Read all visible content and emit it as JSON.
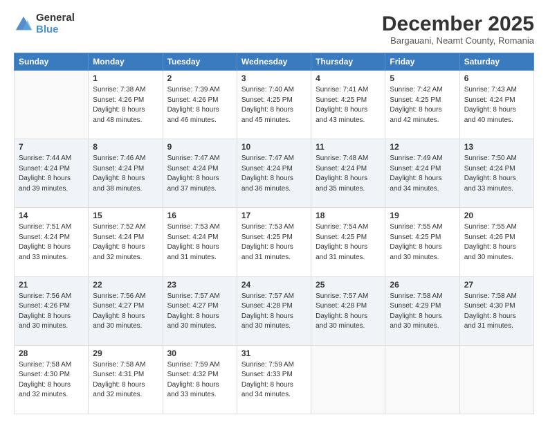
{
  "logo": {
    "general": "General",
    "blue": "Blue"
  },
  "title": "December 2025",
  "subtitle": "Bargauani, Neamt County, Romania",
  "weekdays": [
    "Sunday",
    "Monday",
    "Tuesday",
    "Wednesday",
    "Thursday",
    "Friday",
    "Saturday"
  ],
  "weeks": [
    [
      {
        "day": "",
        "info": ""
      },
      {
        "day": "1",
        "info": "Sunrise: 7:38 AM\nSunset: 4:26 PM\nDaylight: 8 hours\nand 48 minutes."
      },
      {
        "day": "2",
        "info": "Sunrise: 7:39 AM\nSunset: 4:26 PM\nDaylight: 8 hours\nand 46 minutes."
      },
      {
        "day": "3",
        "info": "Sunrise: 7:40 AM\nSunset: 4:25 PM\nDaylight: 8 hours\nand 45 minutes."
      },
      {
        "day": "4",
        "info": "Sunrise: 7:41 AM\nSunset: 4:25 PM\nDaylight: 8 hours\nand 43 minutes."
      },
      {
        "day": "5",
        "info": "Sunrise: 7:42 AM\nSunset: 4:25 PM\nDaylight: 8 hours\nand 42 minutes."
      },
      {
        "day": "6",
        "info": "Sunrise: 7:43 AM\nSunset: 4:24 PM\nDaylight: 8 hours\nand 40 minutes."
      }
    ],
    [
      {
        "day": "7",
        "info": "Sunrise: 7:44 AM\nSunset: 4:24 PM\nDaylight: 8 hours\nand 39 minutes."
      },
      {
        "day": "8",
        "info": "Sunrise: 7:46 AM\nSunset: 4:24 PM\nDaylight: 8 hours\nand 38 minutes."
      },
      {
        "day": "9",
        "info": "Sunrise: 7:47 AM\nSunset: 4:24 PM\nDaylight: 8 hours\nand 37 minutes."
      },
      {
        "day": "10",
        "info": "Sunrise: 7:47 AM\nSunset: 4:24 PM\nDaylight: 8 hours\nand 36 minutes."
      },
      {
        "day": "11",
        "info": "Sunrise: 7:48 AM\nSunset: 4:24 PM\nDaylight: 8 hours\nand 35 minutes."
      },
      {
        "day": "12",
        "info": "Sunrise: 7:49 AM\nSunset: 4:24 PM\nDaylight: 8 hours\nand 34 minutes."
      },
      {
        "day": "13",
        "info": "Sunrise: 7:50 AM\nSunset: 4:24 PM\nDaylight: 8 hours\nand 33 minutes."
      }
    ],
    [
      {
        "day": "14",
        "info": "Sunrise: 7:51 AM\nSunset: 4:24 PM\nDaylight: 8 hours\nand 33 minutes."
      },
      {
        "day": "15",
        "info": "Sunrise: 7:52 AM\nSunset: 4:24 PM\nDaylight: 8 hours\nand 32 minutes."
      },
      {
        "day": "16",
        "info": "Sunrise: 7:53 AM\nSunset: 4:24 PM\nDaylight: 8 hours\nand 31 minutes."
      },
      {
        "day": "17",
        "info": "Sunrise: 7:53 AM\nSunset: 4:25 PM\nDaylight: 8 hours\nand 31 minutes."
      },
      {
        "day": "18",
        "info": "Sunrise: 7:54 AM\nSunset: 4:25 PM\nDaylight: 8 hours\nand 31 minutes."
      },
      {
        "day": "19",
        "info": "Sunrise: 7:55 AM\nSunset: 4:25 PM\nDaylight: 8 hours\nand 30 minutes."
      },
      {
        "day": "20",
        "info": "Sunrise: 7:55 AM\nSunset: 4:26 PM\nDaylight: 8 hours\nand 30 minutes."
      }
    ],
    [
      {
        "day": "21",
        "info": "Sunrise: 7:56 AM\nSunset: 4:26 PM\nDaylight: 8 hours\nand 30 minutes."
      },
      {
        "day": "22",
        "info": "Sunrise: 7:56 AM\nSunset: 4:27 PM\nDaylight: 8 hours\nand 30 minutes."
      },
      {
        "day": "23",
        "info": "Sunrise: 7:57 AM\nSunset: 4:27 PM\nDaylight: 8 hours\nand 30 minutes."
      },
      {
        "day": "24",
        "info": "Sunrise: 7:57 AM\nSunset: 4:28 PM\nDaylight: 8 hours\nand 30 minutes."
      },
      {
        "day": "25",
        "info": "Sunrise: 7:57 AM\nSunset: 4:28 PM\nDaylight: 8 hours\nand 30 minutes."
      },
      {
        "day": "26",
        "info": "Sunrise: 7:58 AM\nSunset: 4:29 PM\nDaylight: 8 hours\nand 30 minutes."
      },
      {
        "day": "27",
        "info": "Sunrise: 7:58 AM\nSunset: 4:30 PM\nDaylight: 8 hours\nand 31 minutes."
      }
    ],
    [
      {
        "day": "28",
        "info": "Sunrise: 7:58 AM\nSunset: 4:30 PM\nDaylight: 8 hours\nand 32 minutes."
      },
      {
        "day": "29",
        "info": "Sunrise: 7:58 AM\nSunset: 4:31 PM\nDaylight: 8 hours\nand 32 minutes."
      },
      {
        "day": "30",
        "info": "Sunrise: 7:59 AM\nSunset: 4:32 PM\nDaylight: 8 hours\nand 33 minutes."
      },
      {
        "day": "31",
        "info": "Sunrise: 7:59 AM\nSunset: 4:33 PM\nDaylight: 8 hours\nand 34 minutes."
      },
      {
        "day": "",
        "info": ""
      },
      {
        "day": "",
        "info": ""
      },
      {
        "day": "",
        "info": ""
      }
    ]
  ]
}
